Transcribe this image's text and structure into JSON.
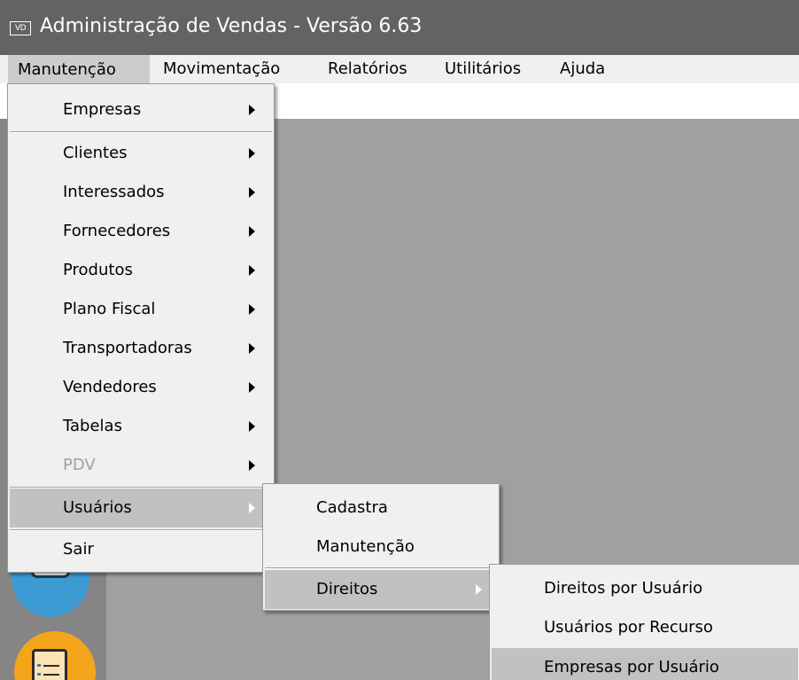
{
  "window": {
    "icon_text": "VD",
    "title": "Administração de Vendas - Versão 6.63"
  },
  "menubar": {
    "items": [
      {
        "label": "Manutenção"
      },
      {
        "label": "Movimentação"
      },
      {
        "label": "Relatórios"
      },
      {
        "label": "Utilitários"
      },
      {
        "label": "Ajuda"
      }
    ]
  },
  "menu_manutencao": {
    "items": [
      {
        "label": "Empresas"
      },
      {
        "label": "Clientes"
      },
      {
        "label": "Interessados"
      },
      {
        "label": "Fornecedores"
      },
      {
        "label": "Produtos"
      },
      {
        "label": "Plano Fiscal"
      },
      {
        "label": "Transportadoras"
      },
      {
        "label": "Vendedores"
      },
      {
        "label": "Tabelas"
      },
      {
        "label": "PDV"
      },
      {
        "label": "Usuários"
      },
      {
        "label": "Sair"
      }
    ]
  },
  "menu_usuarios": {
    "items": [
      {
        "label": "Cadastra"
      },
      {
        "label": "Manutenção"
      },
      {
        "label": "Direitos"
      }
    ]
  },
  "menu_direitos": {
    "items": [
      {
        "label": "Direitos por Usuário"
      },
      {
        "label": "Usuários por Recurso"
      },
      {
        "label": "Empresas por Usuário"
      }
    ]
  },
  "sidebar": {
    "icons": [
      "list-icon",
      "scroll-document-icon"
    ]
  },
  "colors": {
    "titlebar": "#636363",
    "menu_background": "#f0f0f0",
    "highlight": "#c1c1c1",
    "workspace": "#a0a0a0"
  }
}
